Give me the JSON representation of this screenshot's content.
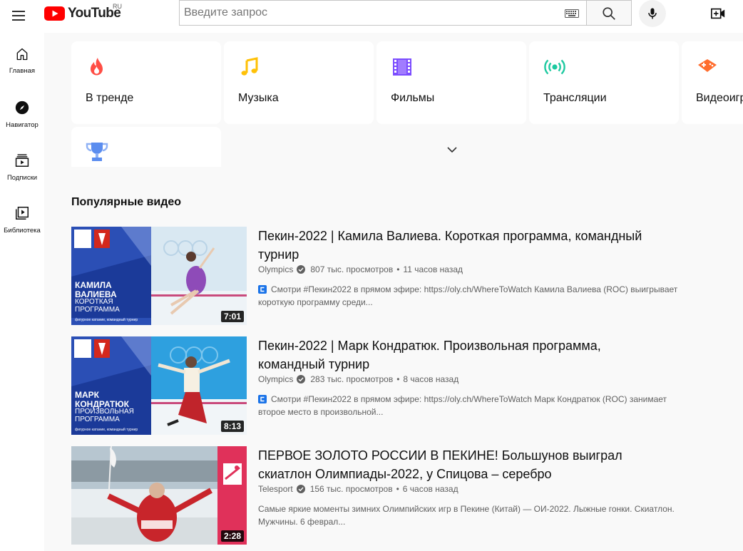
{
  "header": {
    "logo_text": "YouTube",
    "country_code": "RU",
    "search_placeholder": "Введите запрос"
  },
  "sidebar": {
    "items": [
      {
        "label": "Главная",
        "icon": "home-icon"
      },
      {
        "label": "Навигатор",
        "icon": "compass-icon"
      },
      {
        "label": "Подписки",
        "icon": "subscriptions-icon"
      },
      {
        "label": "Библиотека",
        "icon": "library-icon"
      }
    ]
  },
  "categories": [
    {
      "label": "В тренде",
      "icon": "flame-icon",
      "color": "#ff4e45"
    },
    {
      "label": "Музыка",
      "icon": "music-note-icon",
      "color": "#ffc107"
    },
    {
      "label": "Фильмы",
      "icon": "film-icon",
      "color": "#7c4dff"
    },
    {
      "label": "Трансляции",
      "icon": "live-icon",
      "color": "#1dc9a0"
    },
    {
      "label": "Видеоигр",
      "icon": "gamepad-icon",
      "color": "#ff6d2e"
    }
  ],
  "extra_category": {
    "icon": "trophy-icon",
    "color": "#5b8def"
  },
  "section_title": "Популярные видео",
  "videos": [
    {
      "title": "Пекин-2022 | Камила Валиева. Короткая программа, командный турнир",
      "channel": "Olympics",
      "views": "807 тыс. просмотров",
      "age": "11 часов назад",
      "description": "Смотри #Пекин2022 в прямом эфире: https://oly.ch/WhereToWatch Камила Валиева (ROC) выигрывает короткую программу среди...",
      "duration": "7:01",
      "thumb_lines": [
        "КАМИЛА",
        "ВАЛИЕВА",
        "КОРОТКАЯ",
        "ПРОГРАММА",
        "фигурное катание, командный турнир"
      ]
    },
    {
      "title": "Пекин-2022 | Марк Кондратюк. Произвольная программа, командный турнир",
      "channel": "Olympics",
      "views": "283 тыс. просмотров",
      "age": "8 часов назад",
      "description": "Смотри #Пекин2022 в прямом эфире: https://oly.ch/WhereToWatch Марк Кондратюк (ROC) занимает второе место в произвольной...",
      "duration": "8:13",
      "thumb_lines": [
        "МАРК",
        "КОНДРАТЮК",
        "ПРОИЗВОЛЬНАЯ",
        "ПРОГРАММА",
        "фигурное катание, командный турнир"
      ]
    },
    {
      "title": "ПЕРВОЕ ЗОЛОТО РОССИИ В ПЕКИНЕ! Большунов выиграл скиатлон Олимпиады-2022, у Спицова – серебро",
      "channel": "Telesport",
      "views": "156 тыс. просмотров",
      "age": "6 часов назад",
      "description": "Самые яркие моменты зимних Олимпийских игр в Пекине (Китай) — ОИ-2022. Лыжные гонки. Скиатлон. Мужчины. 6 феврал...",
      "duration": "2:28",
      "thumb_lines": []
    }
  ]
}
